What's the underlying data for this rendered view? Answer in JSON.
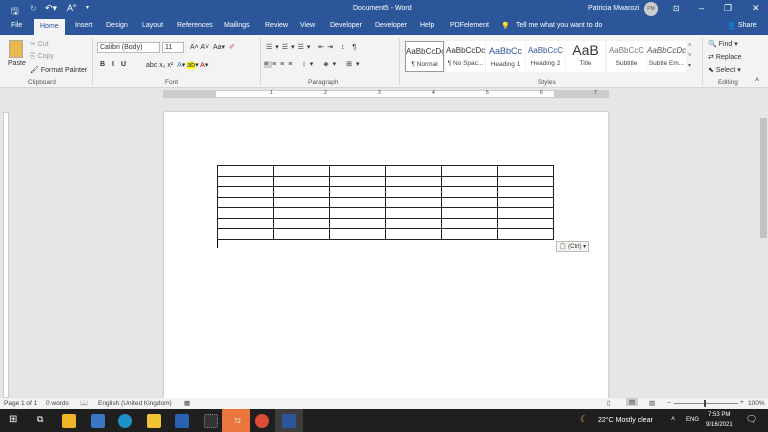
{
  "titlebar": {
    "document_title": "Document5 - Word",
    "user_name": "Patricia Mwarozi",
    "avatar_initials": "PM"
  },
  "tabs": [
    "File",
    "Home",
    "Insert",
    "Design",
    "Layout",
    "References",
    "Mailings",
    "Review",
    "View",
    "Developer",
    "Developer",
    "Help",
    "PDFelement"
  ],
  "tell_me": "Tell me what you want to do",
  "share": "Share",
  "clipboard": {
    "paste": "Paste",
    "cut": "Cut",
    "copy": "Copy",
    "format_painter": "Format Painter",
    "label": "Clipboard"
  },
  "font": {
    "name": "Calibri (Body)",
    "size": "11",
    "label": "Font"
  },
  "paragraph": {
    "label": "Paragraph"
  },
  "styles": {
    "label": "Styles",
    "items": [
      {
        "preview": "AaBbCcDc",
        "name": "¶ Normal"
      },
      {
        "preview": "AaBbCcDc",
        "name": "¶ No Spac..."
      },
      {
        "preview": "AaBbCc",
        "name": "Heading 1"
      },
      {
        "preview": "AaBbCcC",
        "name": "Heading 2"
      },
      {
        "preview": "AaB",
        "name": "Title"
      },
      {
        "preview": "AaBbCcC",
        "name": "Subtitle"
      },
      {
        "preview": "AaBbCcDc",
        "name": "Subtle Em..."
      }
    ]
  },
  "editing": {
    "find": "Find",
    "replace": "Replace",
    "select": "Select",
    "label": "Editing"
  },
  "ruler_numbers": [
    "1",
    "2",
    "3",
    "4",
    "5",
    "6",
    "7"
  ],
  "paste_options": "(Ctrl)",
  "table": {
    "rows": 7,
    "cols": 6
  },
  "status": {
    "page": "Page 1 of 1",
    "words": "0 words",
    "language": "English (United Kingdom)",
    "zoom": "100%"
  },
  "taskbar": {
    "weather": "22°C  Mostly clear",
    "lang": "ENG",
    "time": "7:53 PM",
    "date": "9/16/2021",
    "badge": "72"
  }
}
